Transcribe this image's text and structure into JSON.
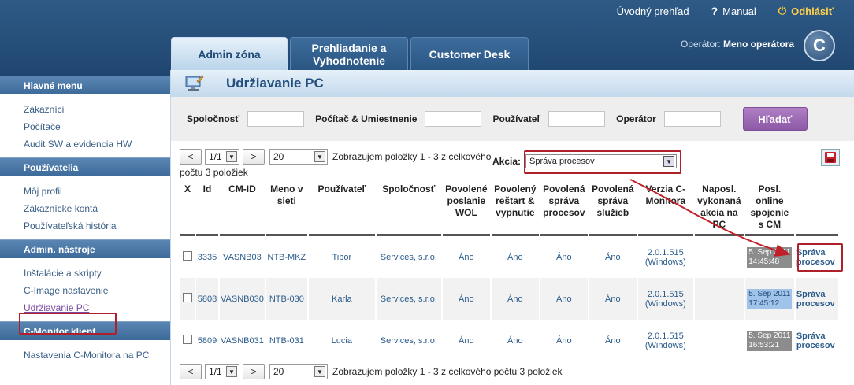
{
  "toplinks": {
    "overview": "Úvodný prehľad",
    "manual": "Manual",
    "logout": "Odhlásiť"
  },
  "tabs": [
    {
      "label": "Admin zóna",
      "active": true
    },
    {
      "label": "Prehliadanie a Vyhodnotenie",
      "active": false
    },
    {
      "label": "Customer Desk",
      "active": false
    }
  ],
  "operator": {
    "label": "Operátor:",
    "name": "Meno operátora"
  },
  "logo": "C",
  "sidebar": {
    "sections": [
      {
        "title": "Hlavné menu",
        "items": [
          "Zákazníci",
          "Počítače",
          "Audit SW a evidencia HW"
        ]
      },
      {
        "title": "Používatelia",
        "items": [
          "Môj profil",
          "Zákaznícke kontá",
          "Používateľská história"
        ]
      },
      {
        "title": "Admin. nástroje",
        "items": [
          "Inštalácie a skripty",
          "C-Image nastavenie",
          "Udržiavanie PC"
        ]
      },
      {
        "title": "C-Monitor klient",
        "items": [
          "Nastavenia C-Monitora na PC"
        ]
      }
    ]
  },
  "page": {
    "title": "Udržiavanie PC"
  },
  "filters": {
    "company": "Spoločnosť",
    "computer": "Počítač & Umiestnenie",
    "user": "Používateľ",
    "operator": "Operátor",
    "search": "Hľadať"
  },
  "pager": {
    "prev": "<",
    "page": "1/1",
    "next": ">",
    "per_page": "20",
    "summary_top_1": "Zobrazujem položky 1 - 3 z celkového",
    "summary_top_2": "počtu 3 položiek",
    "summary_bottom": "Zobrazujem položky 1 - 3 z celkového počtu 3 položiek"
  },
  "action": {
    "label": "Akcia:",
    "value": "Správa procesov"
  },
  "table": {
    "headers": [
      "X",
      "Id",
      "CM-ID",
      "Meno v sieti",
      "Používateľ",
      "Spoločnosť",
      "Povolené poslanie WOL",
      "Povolený reštart & vypnutie",
      "Povolená správa procesov",
      "Povolená správa služieb",
      "Verzia C-Monitora",
      "Naposl. vykonaná akcia na PC",
      "Posl. online spojenie s CM",
      ""
    ],
    "rows": [
      {
        "id": "3335",
        "cmid": "VASNB03",
        "name": "NTB-MKZ",
        "user": "Tibor",
        "company": "Services, s.r.o.",
        "wol": "Áno",
        "restart": "Áno",
        "proc": "Áno",
        "svc": "Áno",
        "ver1": "2.0.1.515",
        "ver2": "(Windows)",
        "last": "",
        "dt1": "5. Sep 2011",
        "dt2": "14:45:48",
        "act1": "Správa",
        "act2": "procesov"
      },
      {
        "id": "5808",
        "cmid": "VASNB030",
        "name": "NTB-030",
        "user": "Karla",
        "company": "Services, s.r.o.",
        "wol": "Áno",
        "restart": "Áno",
        "proc": "Áno",
        "svc": "Áno",
        "ver1": "2.0.1.515",
        "ver2": "(Windows)",
        "last": "",
        "dt1": "5. Sep 2011",
        "dt2": "17:45:12",
        "act1": "Správa",
        "act2": "procesov"
      },
      {
        "id": "5809",
        "cmid": "VASNB031",
        "name": "NTB-031",
        "user": "Lucia",
        "company": "Services, s.r.o.",
        "wol": "Áno",
        "restart": "Áno",
        "proc": "Áno",
        "svc": "Áno",
        "ver1": "2.0.1.515",
        "ver2": "(Windows)",
        "last": "",
        "dt1": "5. Sep 2011",
        "dt2": "16:53:21",
        "act1": "Správa",
        "act2": "procesov"
      }
    ]
  },
  "colors": {
    "header_bg": "#2a5683",
    "accent": "#8c59a6",
    "highlight": "#b0202a"
  }
}
